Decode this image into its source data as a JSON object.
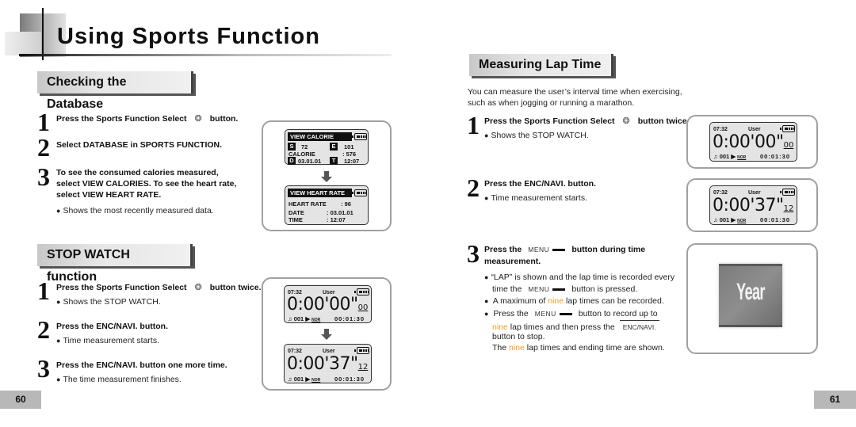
{
  "page_title": "Using Sports Function",
  "left_page": {
    "database_section": {
      "header": "Checking the Database",
      "steps": [
        {
          "num": "1",
          "text_before": "Press the Sports Function Select",
          "icon": "runner-icon",
          "text_after": "button."
        },
        {
          "num": "2",
          "text": "Select DATABASE in SPORTS FUNCTION."
        },
        {
          "num": "3",
          "lines": [
            "To see the consumed calories measured,",
            "select VIEW CALORIES. To see the heart rate,",
            "select VIEW HEART RATE."
          ],
          "bullet": "Shows the most recently measured data."
        }
      ],
      "lcd_calorie": {
        "title": "VIEW CALORIE",
        "s_label": "S",
        "s_value": "72",
        "e_label": "E",
        "e_value": "101",
        "calorie_label": "CALORIE",
        "calorie_value": ":  576",
        "d_label": "D",
        "d_value": "03.01.01",
        "t_label": "T",
        "t_value": "12:07"
      },
      "lcd_heart": {
        "title": "VIEW HEART RATE",
        "hr_label": "HEART RATE",
        "hr_value": ": 96",
        "date_label": "DATE",
        "date_value": ": 03.01.01",
        "time_label": "TIME",
        "time_value": ": 12:07"
      }
    },
    "stopwatch_section": {
      "header": "STOP WATCH function",
      "steps": [
        {
          "num": "1",
          "text_before": "Press the Sports Function Select",
          "icon": "runner-icon",
          "text_after": "button twice.",
          "bullet": "Shows the STOP WATCH."
        },
        {
          "num": "2",
          "text": "Press the ENC/NAVI. button.",
          "bullet": "Time measurement starts."
        },
        {
          "num": "3",
          "text": "Press the ENC/NAVI. button one more time.",
          "bullet": "The time measurement finishes."
        }
      ]
    },
    "page_number": "60"
  },
  "lcd_stopwatch_start": {
    "clock": "07:32",
    "user": "User",
    "time_main": "0:00'00\"",
    "time_cs": "00",
    "track": "001",
    "mode": "NOR",
    "elapsed": "00:01:30"
  },
  "lcd_stopwatch_running": {
    "clock": "07:32",
    "user": "User",
    "time_main": "0:00'37\"",
    "time_cs": "12",
    "track": "001",
    "mode": "NOR",
    "elapsed": "00:01:30"
  },
  "right_page": {
    "lap_section": {
      "header": "Measuring Lap Time",
      "intro": [
        "You can measure the user’s interval time when exercising,",
        "such as when jogging or running a marathon."
      ],
      "steps": [
        {
          "num": "1",
          "text_before": "Press the Sports Function Select",
          "icon": "runner-icon",
          "text_after": "button twice.",
          "bullet": "Shows the STOP WATCH."
        },
        {
          "num": "2",
          "text": "Press the ENC/NAVI. button.",
          "bullet": "Time measurement starts."
        },
        {
          "num": "3",
          "text_before": "Press the",
          "key": "MENU",
          "text_after": "button during time",
          "text_line2": "measurement."
        }
      ],
      "notes": {
        "b1_a": "“LAP” is shown and the lap time is recorded every",
        "b1_b_before": "time the",
        "b1_key": "MENU",
        "b1_b_after": "button is pressed.",
        "b2_before": "A maximum of",
        "b2_hl": "nine",
        "b2_after": "lap times can be recorded.",
        "b3_before": "Press the",
        "b3_key": "MENU",
        "b3_after": "button to record up to",
        "b3_l2_hl": "nine",
        "b3_l2_after": "lap times and then press the",
        "b3_l2_key": "ENC/NAVI.",
        "b3_l3": "button to stop.",
        "p_before": "The",
        "p_hl": "nine",
        "p_after": "lap times and ending time are shown."
      },
      "year_image_text": "Year"
    },
    "page_number": "61"
  },
  "colors": {
    "highlight": "#f0a020",
    "section_shadow": "#555555",
    "page_number_bg": "#b8b8b8"
  }
}
